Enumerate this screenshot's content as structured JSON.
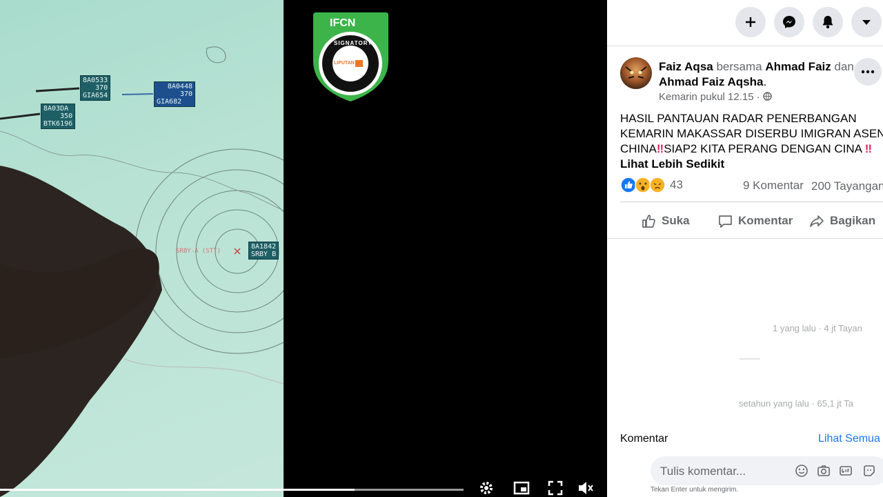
{
  "video": {
    "radar_tags": [
      {
        "line1": "8A0533",
        "line2": "370",
        "line3": "GIA654"
      },
      {
        "line1": "8A0448",
        "line2": "370",
        "line3": "GIA682"
      },
      {
        "line1": "8A03DA",
        "line2": "350",
        "line3": "BTK6196"
      },
      {
        "line1": "8A1842",
        "line2": "SRBY B"
      }
    ],
    "radar_label": "SRBY-A (STT)",
    "logo_title": "IFCN",
    "logo_ring": "SIGNATORY",
    "logo_inner": "LIPUTAN 6",
    "progress": 0.765,
    "controls": [
      "gear-icon",
      "pip-icon",
      "fullscreen-icon",
      "volume-muted-icon"
    ]
  },
  "post": {
    "author": "Faiz Aqsa",
    "with_word": "bersama",
    "tag1": "Ahmad Faiz",
    "and_word": "dan",
    "tag2": "Ahmad Faiz Aqsha",
    "period": ".",
    "time": "Kemarin pukul 12.15 ·",
    "text_line1": "HASIL PANTAUAN RADAR PENERBANGAN",
    "text_line2": "KEMARIN MAKASSAR DISERBU IMIGRAN ASENG",
    "text_line3a": "CHINA",
    "text_line3b": "SIAP2 KITA PERANG DENGAN CINA",
    "see_less": "Lihat Lebih Sedikit",
    "reactions_count": "43",
    "comments_count": "9 Komentar",
    "views": "200 Tayangan",
    "like_label": "Suka",
    "comment_label": "Komentar",
    "share_label": "Bagikan"
  },
  "faded": {
    "line1": "1 yang lalu · 4 jt Tayan",
    "line2": "setahun yang lalu · 65,1 jt Ta"
  },
  "comments": {
    "heading": "Komentar",
    "see_all": "Lihat Semua",
    "placeholder": "Tulis komentar...",
    "hint": "Tekan Enter untuk mengirim."
  },
  "colors": {
    "link": "#1877f2",
    "green": "#3cb44a",
    "icon_bg": "#e4e6eb"
  }
}
